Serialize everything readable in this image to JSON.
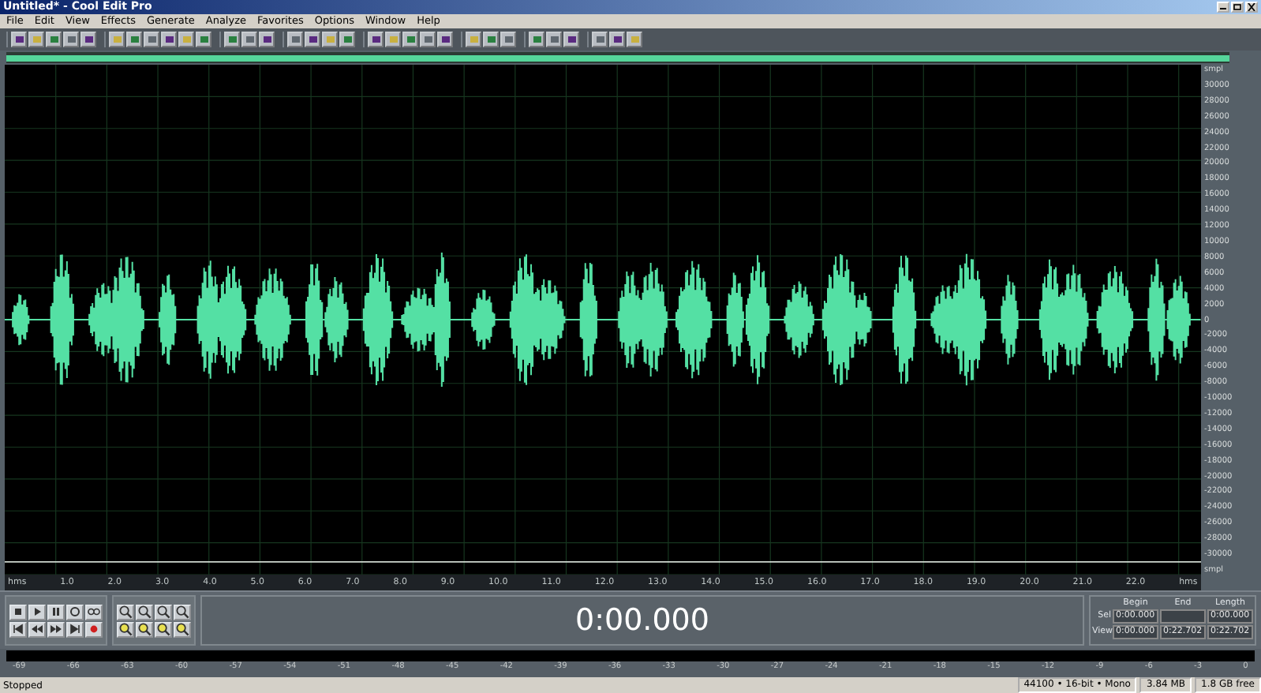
{
  "window": {
    "title": "Untitled* - Cool Edit Pro"
  },
  "menu": [
    "File",
    "Edit",
    "View",
    "Effects",
    "Generate",
    "Analyze",
    "Favorites",
    "Options",
    "Window",
    "Help"
  ],
  "amplitude_scale": [
    "smpl",
    "30000",
    "28000",
    "26000",
    "24000",
    "22000",
    "20000",
    "18000",
    "16000",
    "14000",
    "12000",
    "10000",
    "8000",
    "6000",
    "4000",
    "2000",
    "0",
    "-2000",
    "-4000",
    "-6000",
    "-8000",
    "-10000",
    "-12000",
    "-14000",
    "-16000",
    "-18000",
    "-20000",
    "-22000",
    "-24000",
    "-26000",
    "-28000",
    "-30000",
    "smpl"
  ],
  "time_ruler": [
    "hms",
    "1.0",
    "2.0",
    "3.0",
    "4.0",
    "5.0",
    "6.0",
    "7.0",
    "8.0",
    "9.0",
    "10.0",
    "11.0",
    "12.0",
    "13.0",
    "14.0",
    "15.0",
    "16.0",
    "17.0",
    "18.0",
    "19.0",
    "20.0",
    "21.0",
    "22.0",
    "hms"
  ],
  "time_display": "0:00.000",
  "selection": {
    "headers": [
      "Begin",
      "End",
      "Length"
    ],
    "rows": [
      {
        "label": "Sel",
        "begin": "0:00.000",
        "length": "0:00.000"
      },
      {
        "label": "View",
        "begin": "0:00.000",
        "end": "0:22.702",
        "length": "0:22.702"
      }
    ]
  },
  "level_scale": [
    "-69",
    "-66",
    "-63",
    "-60",
    "-57",
    "-54",
    "-51",
    "-48",
    "-45",
    "-42",
    "-39",
    "-36",
    "-33",
    "-30",
    "-27",
    "-24",
    "-21",
    "-18",
    "-15",
    "-12",
    "-9",
    "-6",
    "-3",
    "0"
  ],
  "status_bar": {
    "state": "Stopped",
    "fields": [
      "44100 • 16-bit • Mono",
      "3.84 MB",
      "1.8 GB free"
    ]
  }
}
